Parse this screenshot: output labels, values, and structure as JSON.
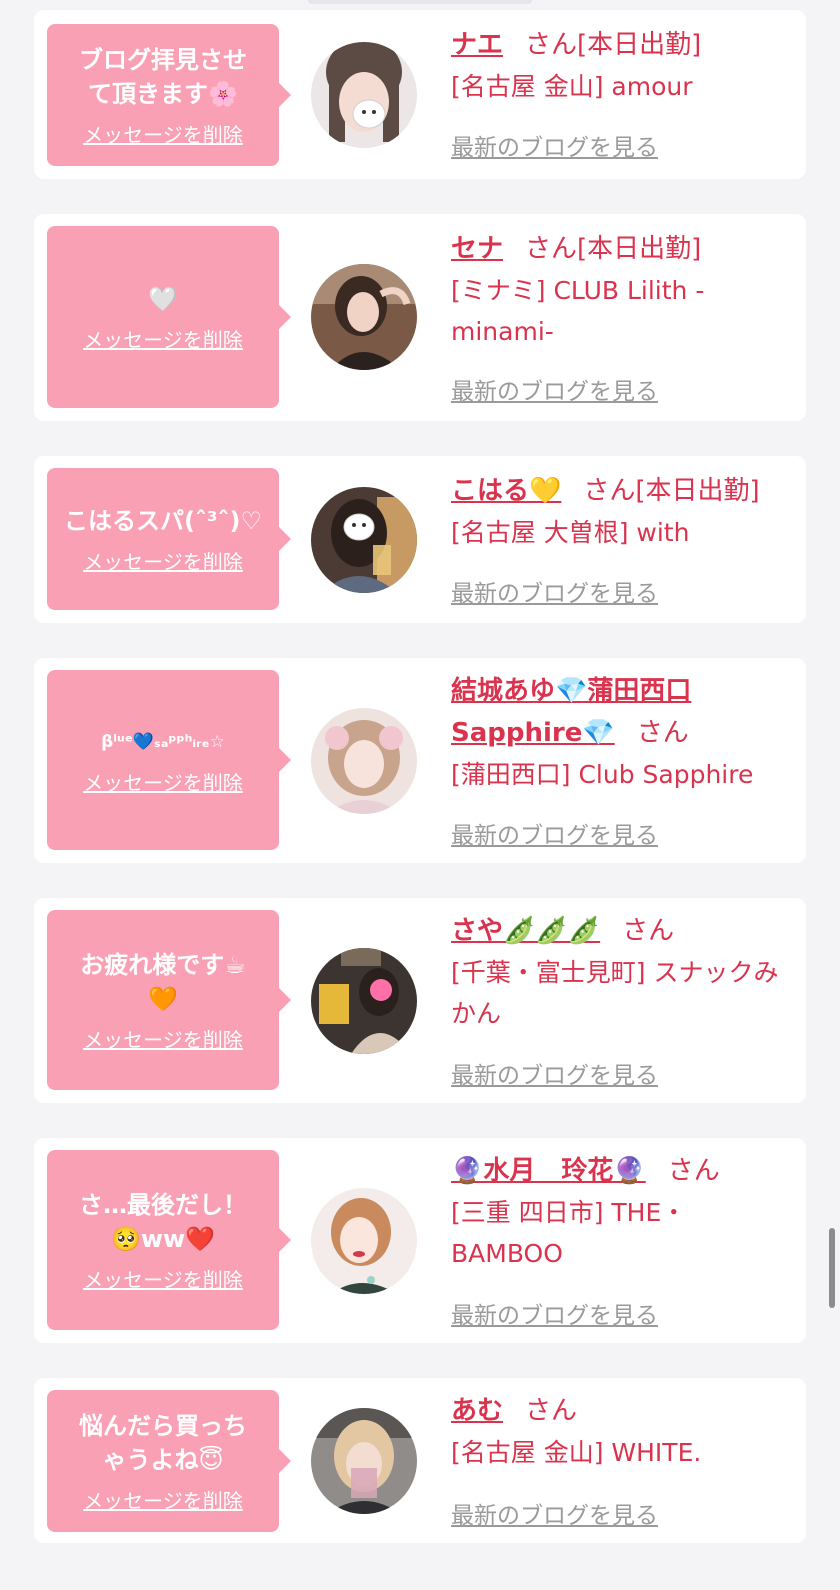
{
  "delete_label": "メッセージを削除",
  "blog_label": "最新のブログを見る",
  "san": "さん",
  "items": [
    {
      "message": "ブログ拝見させて頂きます🌸",
      "name": "ナエ",
      "status": "[本日出勤]",
      "shop": "[名古屋 金山] amour"
    },
    {
      "message": "🤍",
      "name": "セナ",
      "status": "[本日出勤]",
      "shop": "[ミナミ] CLUB Lilith -minami-"
    },
    {
      "message": "こはるスパ(ˆ³ˆ)♡",
      "name": "こはる💛",
      "status": "[本日出勤]",
      "shop": "[名古屋 大曽根] with"
    },
    {
      "message": "βˡᵘᵉ💙ₛₐᵖᵖʰᵢᵣₑ☆",
      "name": "結城あゆ💎蒲田西口Sapphire💎",
      "status": "",
      "shop": "[蒲田西口] Club Sapphire"
    },
    {
      "message": "お疲れ様です☕🧡",
      "name": "さや🫛🫛🫛",
      "status": "",
      "shop": "[千葉・富士見町] スナックみかん"
    },
    {
      "message": "さ…最後だし！🥺ww❤️",
      "name": "🔮水月　玲花🔮",
      "status": "",
      "shop": "[三重 四日市] THE・BAMBOO"
    },
    {
      "message": "悩んだら買っちゃうよね😇",
      "name": "あむ",
      "status": "",
      "shop": "[名古屋 金山] WHITE."
    }
  ]
}
